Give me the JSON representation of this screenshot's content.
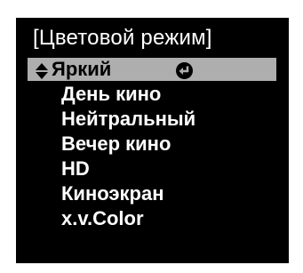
{
  "menu": {
    "title": "[Цветовой режим]",
    "items": [
      {
        "label": "Яркий",
        "selected": true,
        "icons": [
          "updown-arrow-icon",
          "enter-return-icon"
        ]
      },
      {
        "label": "День кино"
      },
      {
        "label": "Нейтральный"
      },
      {
        "label": "Вечер кино"
      },
      {
        "label": "HD"
      },
      {
        "label": "Киноэкран"
      },
      {
        "label": "x.v.Color"
      }
    ]
  },
  "colors": {
    "panel_background": "#000000",
    "text": "#ffffff",
    "selected_highlight": "#aeaeae",
    "selected_text": "#000000"
  }
}
